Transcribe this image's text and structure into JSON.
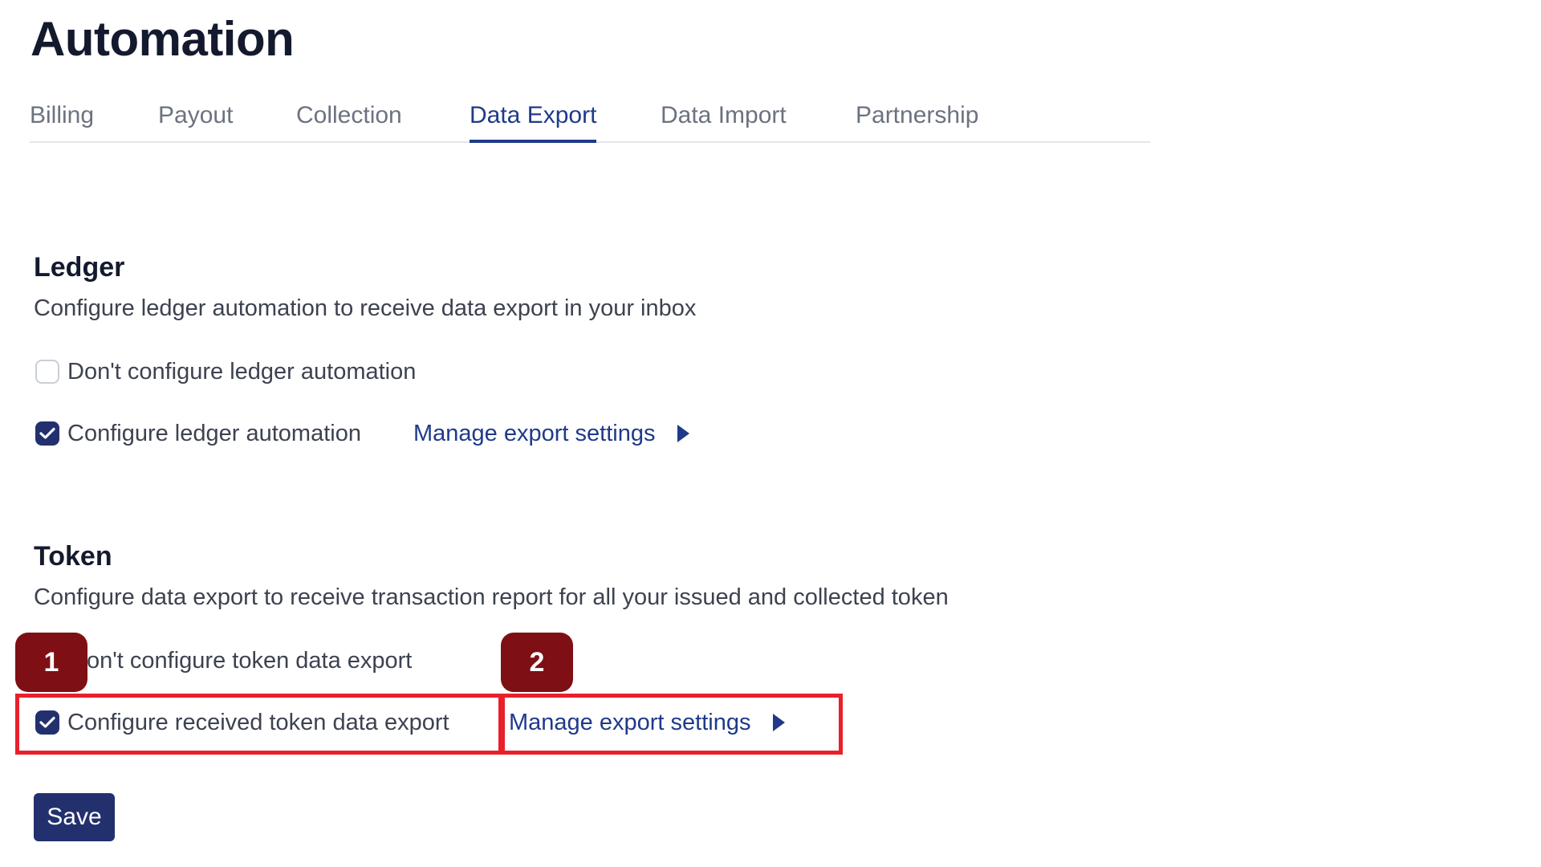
{
  "page": {
    "title": "Automation"
  },
  "tabs": [
    {
      "label": "Billing",
      "active": false
    },
    {
      "label": "Payout",
      "active": false
    },
    {
      "label": "Collection",
      "active": false
    },
    {
      "label": "Data Export",
      "active": true
    },
    {
      "label": "Data Import",
      "active": false
    },
    {
      "label": "Partnership",
      "active": false
    }
  ],
  "ledger": {
    "title": "Ledger",
    "description": "Configure ledger automation to receive data export in your inbox",
    "options": [
      {
        "label": "Don't configure ledger automation",
        "checked": false
      },
      {
        "label": "Configure ledger automation",
        "checked": true
      }
    ],
    "manage_link": "Manage export settings"
  },
  "token": {
    "title": "Token",
    "description": "Configure data export to receive transaction report for all your issued and collected token",
    "options": [
      {
        "label": "on't configure token data export",
        "checked": false
      },
      {
        "label": "Configure received token data export",
        "checked": true
      }
    ],
    "manage_link": "Manage export settings"
  },
  "annotations": {
    "badge_1": "1",
    "badge_2": "2",
    "highlight_color": "#e8202b",
    "badge_color": "#7e0f14"
  },
  "actions": {
    "save_label": "Save"
  },
  "colors": {
    "accent": "#1f3a8a",
    "button": "#22306e",
    "checkbox_checked": "#22306e"
  },
  "icons": {
    "checkbox_checked": "check-icon",
    "manage_link_arrow": "caret-right-icon"
  }
}
